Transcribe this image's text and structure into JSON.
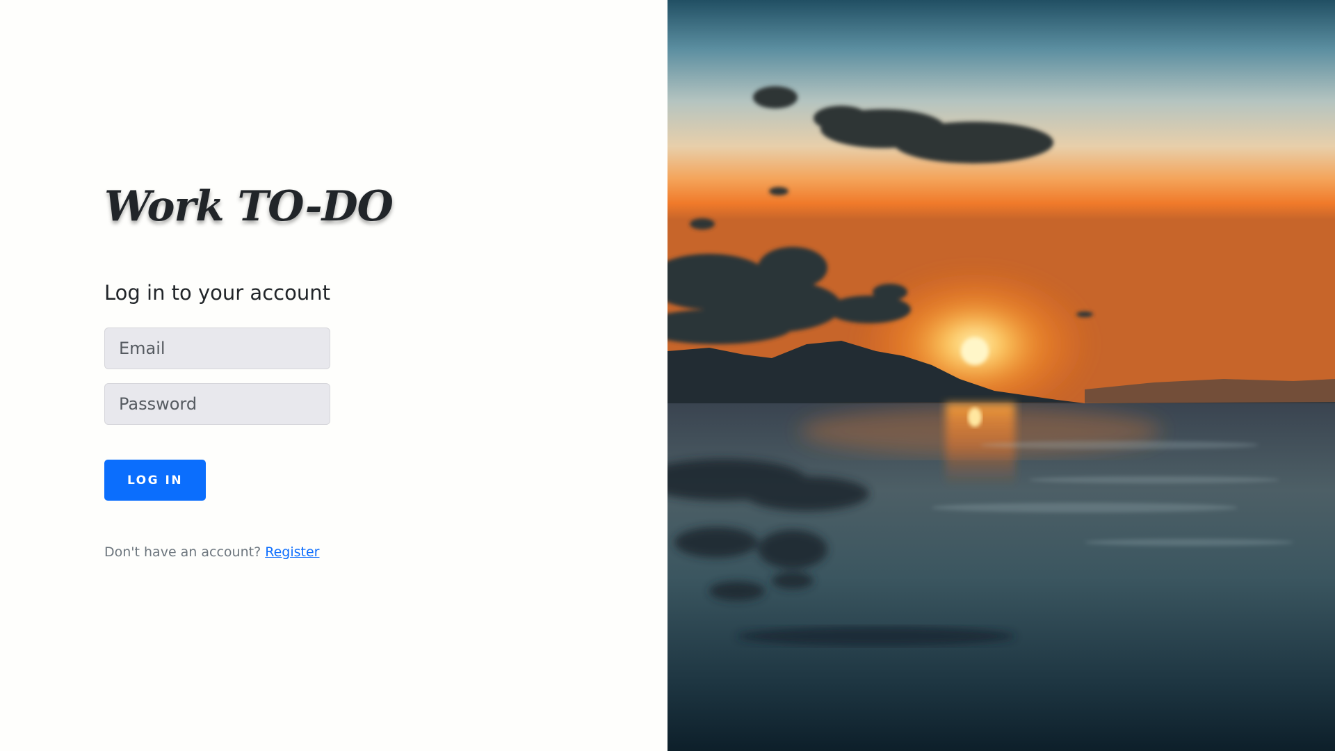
{
  "brand": {
    "title": "Work TO-DO"
  },
  "login": {
    "heading": "Log in to your account",
    "email_placeholder": "Email",
    "email_value": "",
    "password_placeholder": "Password",
    "password_value": "",
    "button_label": "LOG IN",
    "register_prompt": "Don't have an account?",
    "register_link": "Register"
  },
  "colors": {
    "primary": "#0b6efd",
    "link": "#0d6efd",
    "text": "#212529",
    "muted": "#6c757d",
    "input_bg": "#e8e8ed",
    "page_bg": "#fefefc"
  },
  "hero_image": {
    "icon": "sunset-landscape-image"
  }
}
